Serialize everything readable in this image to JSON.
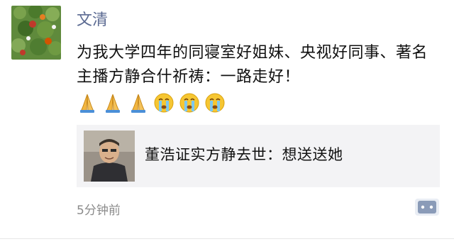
{
  "post": {
    "author": "文清",
    "text": "为我大学四年的同寝室好姐妹、央视好同事、著名主播方静合什祈祷：一路走好！",
    "emojis": [
      "praying-hands-icon",
      "praying-hands-icon",
      "praying-hands-icon",
      "crying-face-icon",
      "crying-face-icon",
      "crying-face-icon"
    ],
    "link": {
      "title": "董浩证实方静去世：想送送她"
    },
    "timestamp": "5分钟前"
  },
  "colors": {
    "author": "#5b6a92",
    "card_bg": "#f3f3f5",
    "timestamp": "#8b8b8b",
    "comment_btn": "#8a9bb8"
  }
}
